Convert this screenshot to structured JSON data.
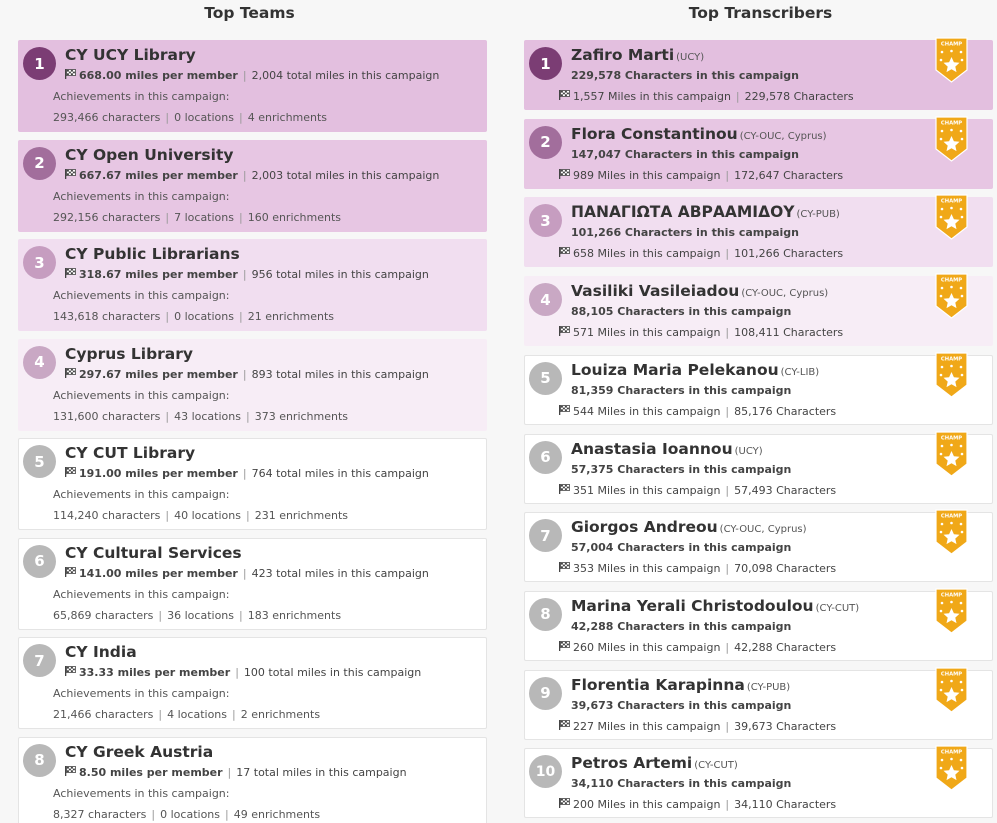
{
  "colors": {
    "card_bg": [
      "#e3bfdf",
      "#e7c6e3",
      "#f1def0",
      "#f7edf6",
      "#ffffff",
      "#ffffff",
      "#ffffff",
      "#ffffff",
      "#ffffff",
      "#ffffff"
    ],
    "circle_bg": [
      "#7b3d74",
      "#a26e9c",
      "#c69dc0",
      "#c9a8c4",
      "#b8b8b8",
      "#b8b8b8",
      "#b8b8b8",
      "#b8b8b8",
      "#b8b8b8",
      "#b8b8b8"
    ],
    "champ_gold": "#f0a818"
  },
  "icons": {
    "flag": "checkered-flag-icon",
    "badge": "champ-badge-icon"
  },
  "top_teams": {
    "title": "Top Teams",
    "achievements_label": "Achievements in this campaign:",
    "items": [
      {
        "rank": "1",
        "name": "CY UCY Library",
        "miles_per_member": "668.00 miles per member",
        "total_miles": "2,004 total miles in this campaign",
        "characters": "293,466 characters",
        "locations": "0 locations",
        "enrichments": "4 enrichments"
      },
      {
        "rank": "2",
        "name": "CY Open University",
        "miles_per_member": "667.67 miles per member",
        "total_miles": "2,003 total miles in this campaign",
        "characters": "292,156 characters",
        "locations": "7 locations",
        "enrichments": "160 enrichments"
      },
      {
        "rank": "3",
        "name": "CY Public Librarians",
        "miles_per_member": "318.67 miles per member",
        "total_miles": "956 total miles in this campaign",
        "characters": "143,618 characters",
        "locations": "0 locations",
        "enrichments": "21 enrichments"
      },
      {
        "rank": "4",
        "name": "Cyprus Library",
        "miles_per_member": "297.67 miles per member",
        "total_miles": "893 total miles in this campaign",
        "characters": "131,600 characters",
        "locations": "43 locations",
        "enrichments": "373 enrichments"
      },
      {
        "rank": "5",
        "name": "CY CUT Library",
        "miles_per_member": "191.00 miles per member",
        "total_miles": "764 total miles in this campaign",
        "characters": "114,240 characters",
        "locations": "40 locations",
        "enrichments": "231 enrichments"
      },
      {
        "rank": "6",
        "name": "CY Cultural Services",
        "miles_per_member": "141.00 miles per member",
        "total_miles": "423 total miles in this campaign",
        "characters": "65,869 characters",
        "locations": "36 locations",
        "enrichments": "183 enrichments"
      },
      {
        "rank": "7",
        "name": "CY India",
        "miles_per_member": "33.33 miles per member",
        "total_miles": "100 total miles in this campaign",
        "characters": "21,466 characters",
        "locations": "4 locations",
        "enrichments": "2 enrichments"
      },
      {
        "rank": "8",
        "name": "CY Greek Austria",
        "miles_per_member": "8.50 miles per member",
        "total_miles": "17 total miles in this campaign",
        "characters": "8,327 characters",
        "locations": "0 locations",
        "enrichments": "49 enrichments"
      }
    ]
  },
  "top_transcribers": {
    "title": "Top Transcribers",
    "badge_label": "CHAMP",
    "items": [
      {
        "rank": "1",
        "name": "Zafiro Marti",
        "team": "(UCY)",
        "campaign_chars": "229,578 Characters in this campaign",
        "miles": "1,557 Miles in this campaign",
        "total_chars": "229,578 Characters"
      },
      {
        "rank": "2",
        "name": "Flora Constantinou",
        "team": "(CY-OUC, Cyprus)",
        "campaign_chars": "147,047 Characters in this campaign",
        "miles": "989 Miles in this campaign",
        "total_chars": "172,647 Characters"
      },
      {
        "rank": "3",
        "name": "ΠΑΝΑΓΙΩΤΑ ΑΒΡΑΑΜΙΔΟΥ",
        "team": "(CY-PUB)",
        "campaign_chars": "101,266 Characters in this campaign",
        "miles": "658 Miles in this campaign",
        "total_chars": "101,266 Characters"
      },
      {
        "rank": "4",
        "name": "Vasiliki Vasileiadou",
        "team": "(CY-OUC, Cyprus)",
        "campaign_chars": "88,105 Characters in this campaign",
        "miles": "571 Miles in this campaign",
        "total_chars": "108,411 Characters"
      },
      {
        "rank": "5",
        "name": "Louiza Maria Pelekanou",
        "team": "(CY-LIB)",
        "campaign_chars": "81,359 Characters in this campaign",
        "miles": "544 Miles in this campaign",
        "total_chars": "85,176 Characters"
      },
      {
        "rank": "6",
        "name": "Anastasia Ioannou",
        "team": "(UCY)",
        "campaign_chars": "57,375 Characters in this campaign",
        "miles": "351 Miles in this campaign",
        "total_chars": "57,493 Characters"
      },
      {
        "rank": "7",
        "name": "Giorgos Andreou",
        "team": "(CY-OUC, Cyprus)",
        "campaign_chars": "57,004 Characters in this campaign",
        "miles": "353 Miles in this campaign",
        "total_chars": "70,098 Characters"
      },
      {
        "rank": "8",
        "name": "Marina Yerali Christodoulou",
        "team": "(CY-CUT)",
        "campaign_chars": "42,288 Characters in this campaign",
        "miles": "260 Miles in this campaign",
        "total_chars": "42,288 Characters"
      },
      {
        "rank": "9",
        "name": "Florentia Karapinna",
        "team": "(CY-PUB)",
        "campaign_chars": "39,673 Characters in this campaign",
        "miles": "227 Miles in this campaign",
        "total_chars": "39,673 Characters"
      },
      {
        "rank": "10",
        "name": "Petros Artemi",
        "team": "(CY-CUT)",
        "campaign_chars": "34,110 Characters in this campaign",
        "miles": "200 Miles in this campaign",
        "total_chars": "34,110 Characters"
      }
    ]
  }
}
